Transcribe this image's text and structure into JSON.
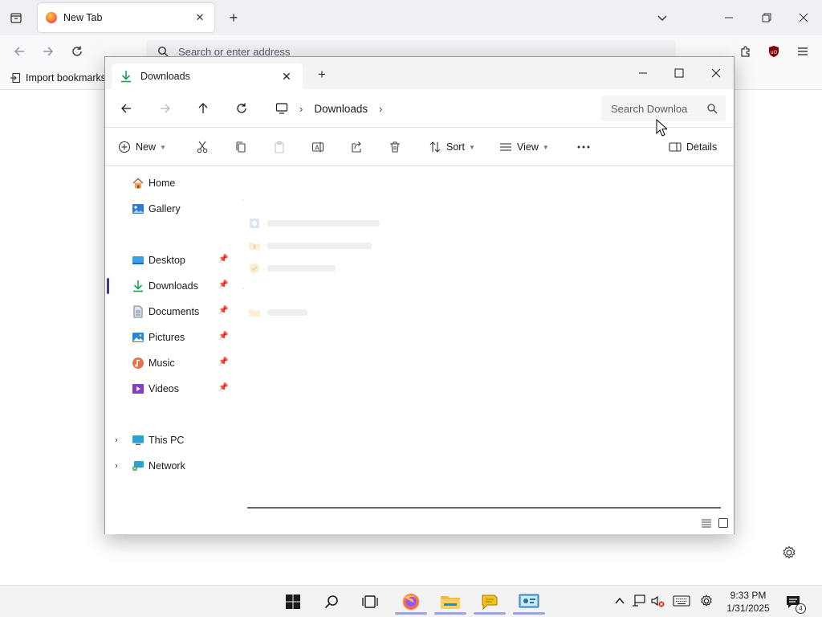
{
  "browser": {
    "tab_title": "New Tab",
    "url_placeholder": "Search or enter address",
    "import_bookmarks": "Import bookmarks"
  },
  "explorer": {
    "tab_title": "Downloads",
    "breadcrumb": [
      "Downloads"
    ],
    "search_placeholder": "Search Downloa",
    "toolbar": {
      "new_label": "New",
      "sort_label": "Sort",
      "view_label": "View",
      "details_label": "Details"
    },
    "nav": {
      "home": "Home",
      "gallery": "Gallery",
      "desktop": "Desktop",
      "downloads": "Downloads",
      "documents": "Documents",
      "pictures": "Pictures",
      "music": "Music",
      "videos": "Videos",
      "this_pc": "This PC",
      "network": "Network"
    }
  },
  "taskbar": {
    "time": "9:33 PM",
    "date": "1/31/2025",
    "notification_count": "4"
  },
  "colors": {
    "accent": "#0067c0",
    "downloads_green": "#1e9e5a",
    "firefox_orange": "#ff7139",
    "selection_bar": "#3a3a8a"
  }
}
